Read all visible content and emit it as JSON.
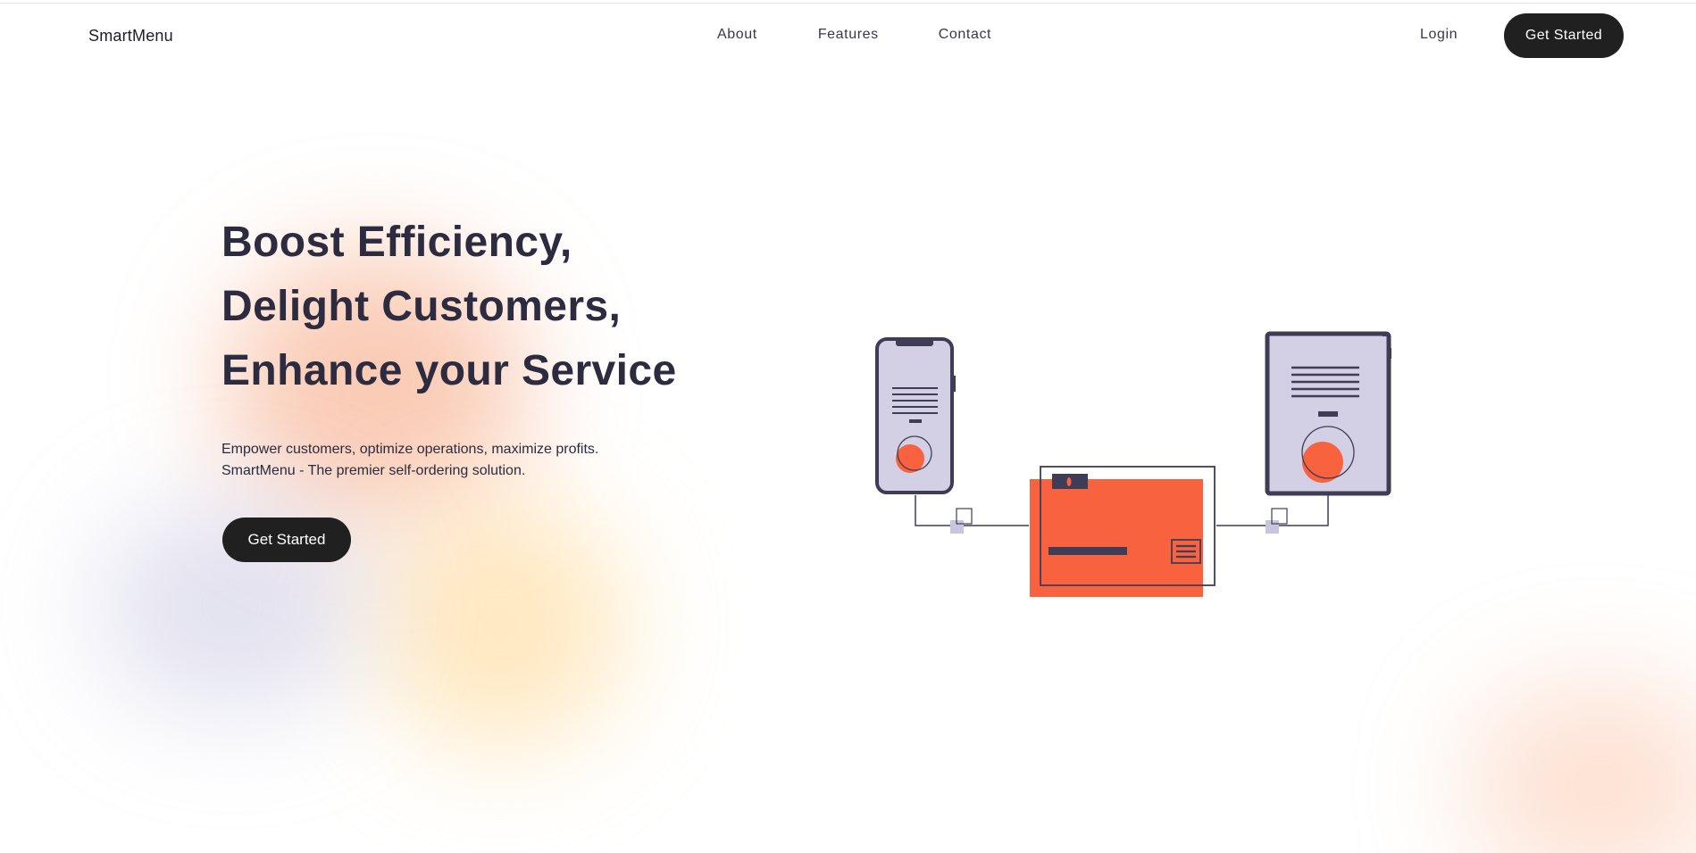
{
  "nav": {
    "logo": "SmartMenu",
    "links": [
      "About",
      "Features",
      "Contact"
    ],
    "login": "Login",
    "cta": "Get Started"
  },
  "hero": {
    "title_lines": [
      "Boost Efficiency,",
      "Delight Customers,",
      "Enhance your Service"
    ],
    "subtitle_lines": [
      "Empower customers, optimize operations, maximize profits.",
      "SmartMenu - The premier self-ordering solution."
    ],
    "cta": "Get Started"
  },
  "illustration": {
    "name": "devices-connected-to-terminal-illustration",
    "colors": {
      "accent": "#f8623e",
      "device_fill": "#d3cfe4",
      "outline": "#3f3d56",
      "connector": "#c8c6dc"
    }
  },
  "colors": {
    "button_bg": "#202020",
    "button_text": "#ffffff",
    "heading": "#2d2b3f"
  }
}
